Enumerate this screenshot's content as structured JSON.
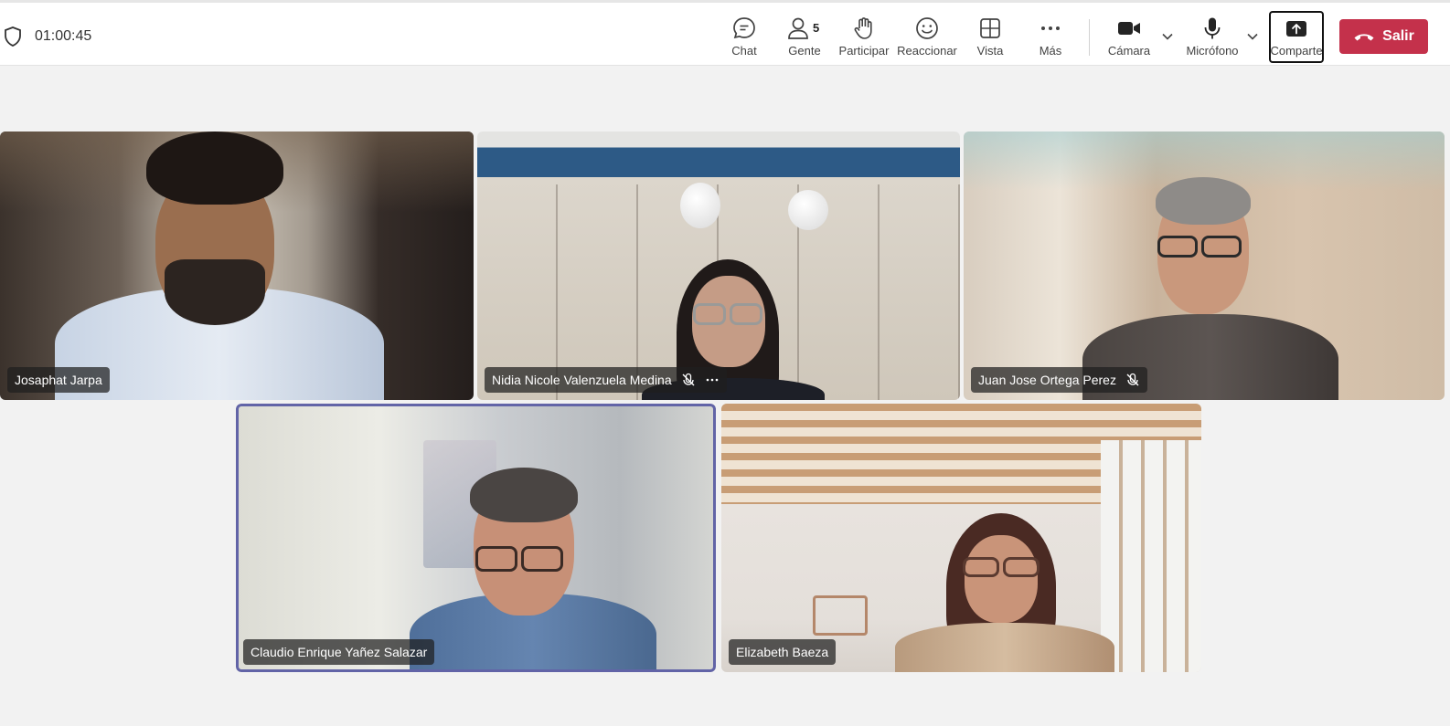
{
  "meeting": {
    "elapsed_time": "01:00:45"
  },
  "toolbar": {
    "chat_label": "Chat",
    "people_label": "Gente",
    "people_count": "5",
    "raise_label": "Participar",
    "react_label": "Reaccionar",
    "view_label": "Vista",
    "more_label": "Más",
    "camera_label": "Cámara",
    "mic_label": "Micrófono",
    "share_label": "Comparte",
    "leave_label": "Salir"
  },
  "participants": [
    {
      "name": "Josaphat Jarpa",
      "muted": false
    },
    {
      "name": "Nidia Nicole Valenzuela Medina",
      "muted": true
    },
    {
      "name": "Juan Jose Ortega Perez",
      "muted": true
    },
    {
      "name": "Claudio Enrique Yañez Salazar",
      "muted": false,
      "active_speaker": true
    },
    {
      "name": "Elizabeth Baeza",
      "muted": false
    }
  ],
  "colors": {
    "leave": "#c4314b",
    "active_border": "#6264a7"
  }
}
